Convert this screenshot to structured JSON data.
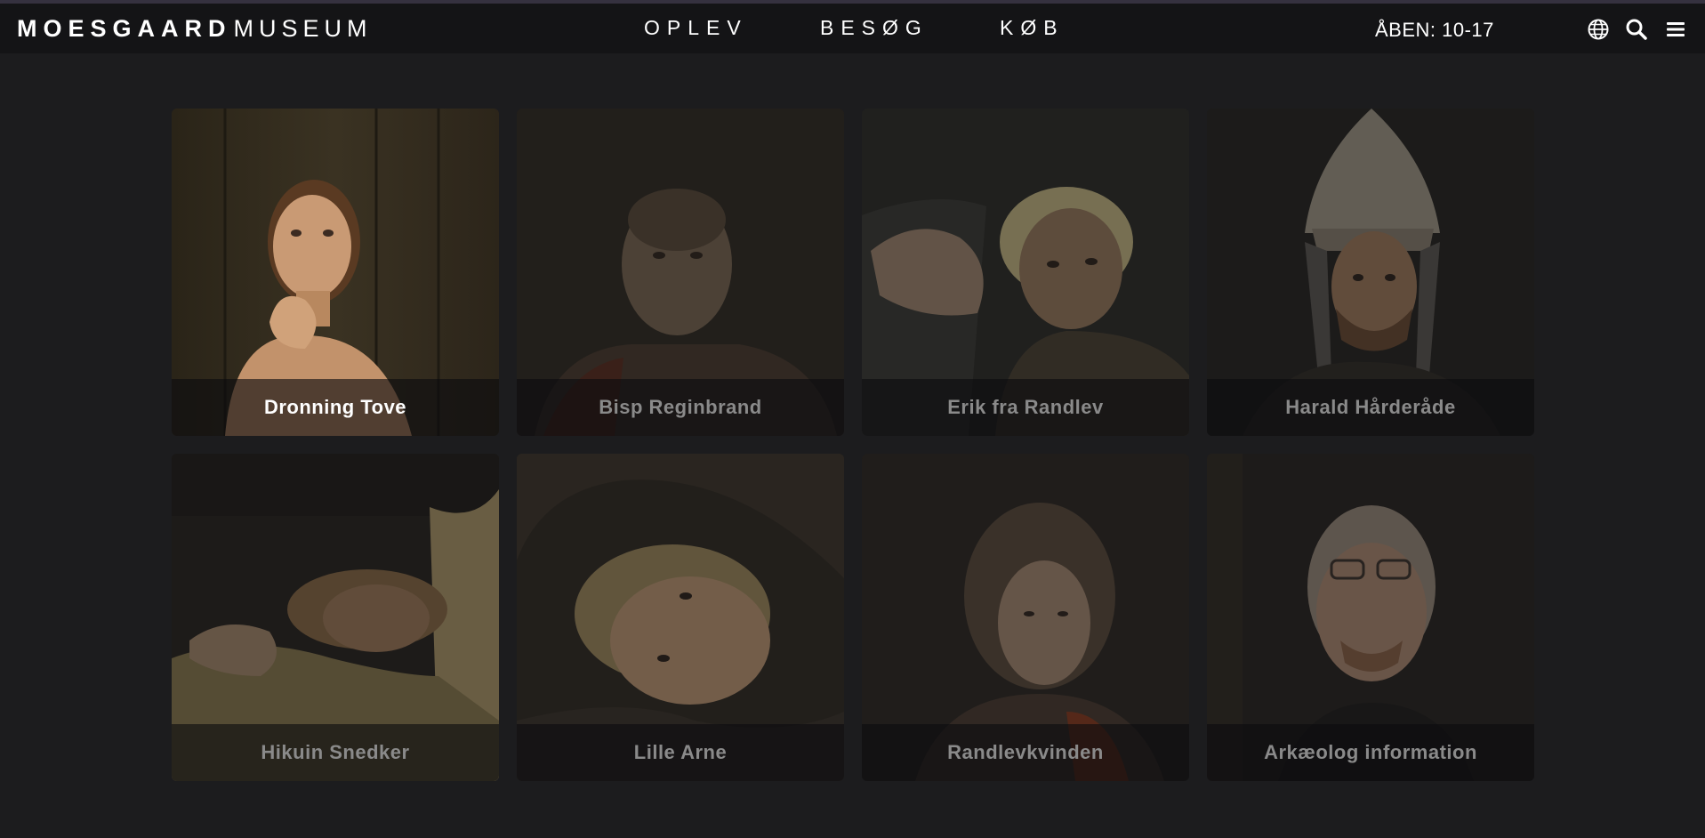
{
  "header": {
    "logo_bold": "MOESGAARD",
    "logo_light": "MUSEUM",
    "nav": [
      {
        "label": "OPLEV"
      },
      {
        "label": "BESØG"
      },
      {
        "label": "KØB"
      }
    ],
    "opening_hours": "ÅBEN: 10-17",
    "icons": [
      "globe-icon",
      "search-icon",
      "menu-icon"
    ]
  },
  "cards": [
    {
      "title": "Dronning Tove",
      "active": true
    },
    {
      "title": "Bisp Reginbrand",
      "active": false
    },
    {
      "title": "Erik fra Randlev",
      "active": false
    },
    {
      "title": "Harald Hårderåde",
      "active": false
    },
    {
      "title": "Hikuin Snedker",
      "active": false
    },
    {
      "title": "Lille Arne",
      "active": false
    },
    {
      "title": "Randlevkvinden",
      "active": false
    },
    {
      "title": "Arkæolog information",
      "active": false
    }
  ],
  "colors": {
    "background": "#1c1c1e",
    "navbar": "#141416",
    "text_active": "#ffffff",
    "text_inactive": "#8a8a8a"
  }
}
